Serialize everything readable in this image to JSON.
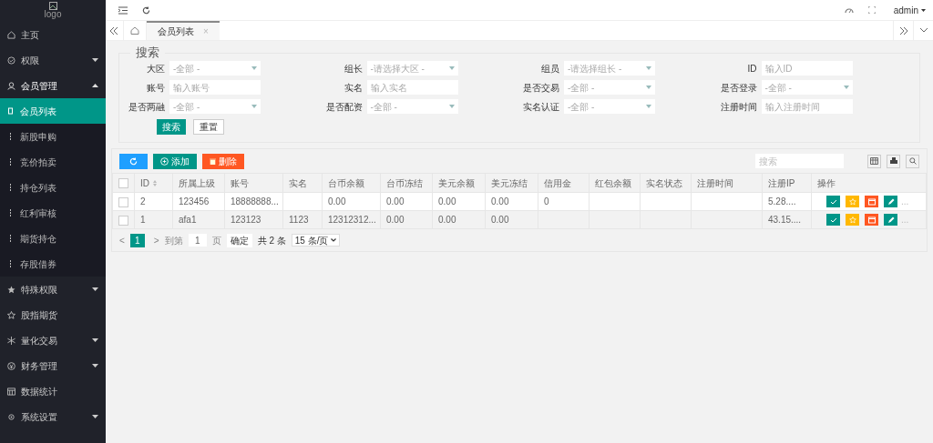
{
  "logo": {
    "alt": "logo"
  },
  "sidebar": {
    "items": [
      {
        "label": "主页",
        "has_children": false,
        "expanded": false
      },
      {
        "label": "权限",
        "has_children": true,
        "expanded": false
      },
      {
        "label": "会员管理",
        "has_children": true,
        "expanded": true,
        "children": [
          {
            "label": "会员列表",
            "selected": true
          },
          {
            "label": "新股申购",
            "selected": false
          },
          {
            "label": "竞价拍卖",
            "selected": false
          },
          {
            "label": "持仓列表",
            "selected": false
          },
          {
            "label": "红利审核",
            "selected": false
          },
          {
            "label": "期货持仓",
            "selected": false
          },
          {
            "label": "存股借券",
            "selected": false
          }
        ]
      },
      {
        "label": "特殊权限",
        "has_children": true,
        "expanded": false
      },
      {
        "label": "股指期货",
        "has_children": false,
        "expanded": false
      },
      {
        "label": "量化交易",
        "has_children": true,
        "expanded": false
      },
      {
        "label": "财务管理",
        "has_children": true,
        "expanded": false
      },
      {
        "label": "数据统计",
        "has_children": false,
        "expanded": false
      },
      {
        "label": "系统设置",
        "has_children": true,
        "expanded": false
      }
    ]
  },
  "header": {
    "user": "admin"
  },
  "tabs": [
    {
      "label": "会员列表",
      "selected": true,
      "close": "×"
    }
  ],
  "search": {
    "legend": "搜索",
    "fields": [
      {
        "label": "大区",
        "kind": "select",
        "placeholder": "-全部 -"
      },
      {
        "label": "组长",
        "kind": "select",
        "placeholder": "-请选择大区 -"
      },
      {
        "label": "组员",
        "kind": "select",
        "placeholder": "-请选择组长 -"
      },
      {
        "label": "ID",
        "kind": "input",
        "placeholder": "输入ID"
      },
      {
        "label": "账号",
        "kind": "input",
        "placeholder": "输入账号"
      },
      {
        "label": "实名",
        "kind": "input",
        "placeholder": "输入实名"
      },
      {
        "label": "是否交易",
        "kind": "select",
        "placeholder": "-全部 -"
      },
      {
        "label": "是否登录",
        "kind": "select",
        "placeholder": "-全部 -"
      },
      {
        "label": "是否两融",
        "kind": "select",
        "placeholder": "-全部 -"
      },
      {
        "label": "是否配资",
        "kind": "select",
        "placeholder": "-全部 -"
      },
      {
        "label": "实名认证",
        "kind": "select",
        "placeholder": "-全部 -"
      },
      {
        "label": "注册时间",
        "kind": "input",
        "placeholder": "输入注册时间"
      }
    ],
    "buttons": [
      "搜索",
      "重置"
    ]
  },
  "toolbar": {
    "add": "添加",
    "delete": "删除",
    "search_placeholder": "搜索"
  },
  "table": {
    "header_checked": false,
    "columns": [
      {
        "label": "ID",
        "sortable": true
      },
      {
        "label": "所属上级",
        "sortable": false
      },
      {
        "label": "账号",
        "sortable": false
      },
      {
        "label": "实名",
        "sortable": false
      },
      {
        "label": "台币余额",
        "sortable": false
      },
      {
        "label": "台币冻结",
        "sortable": false
      },
      {
        "label": "美元余额",
        "sortable": false
      },
      {
        "label": "美元冻结",
        "sortable": false
      },
      {
        "label": "信用金",
        "sortable": false
      },
      {
        "label": "红包余额",
        "sortable": false
      },
      {
        "label": "实名状态",
        "sortable": false
      },
      {
        "label": "注册时间",
        "sortable": false
      },
      {
        "label": "注册IP",
        "sortable": false
      },
      {
        "label": "操作",
        "sortable": false
      }
    ],
    "rows": [
      {
        "checked": false,
        "cells": [
          "2",
          "123456",
          "18888888...",
          "",
          "0.00",
          "0.00",
          "0.00",
          "0.00",
          "0",
          "",
          "",
          "",
          "5.28...."
        ]
      },
      {
        "checked": false,
        "cells": [
          "1",
          "afa1",
          "123123",
          "1123",
          "12312312...",
          "0.00",
          "0.00",
          "0.00",
          "",
          "",
          "",
          "",
          "43.15...."
        ]
      }
    ],
    "row_actions": [
      {
        "kind": "check",
        "color": "#009688"
      },
      {
        "kind": "star",
        "color": "#ffb800"
      },
      {
        "kind": "window",
        "color": "#ff5722"
      },
      {
        "kind": "edit",
        "color": "#009688"
      }
    ],
    "more": "..."
  },
  "pagination": {
    "prev": "<",
    "pages": [
      {
        "label": "1",
        "selected": true
      }
    ],
    "next": ">",
    "goto": "到第",
    "page_input": "1",
    "page_unit": "页",
    "confirm": "确定",
    "total": "共 2 条",
    "page_size": "15 条/页"
  }
}
